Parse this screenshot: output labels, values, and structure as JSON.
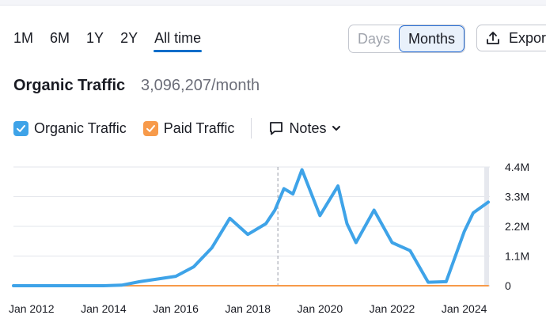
{
  "ranges": [
    {
      "label": "1M",
      "active": false
    },
    {
      "label": "6M",
      "active": false
    },
    {
      "label": "1Y",
      "active": false
    },
    {
      "label": "2Y",
      "active": false
    },
    {
      "label": "All time",
      "active": true
    }
  ],
  "granularity": {
    "days": "Days",
    "months": "Months",
    "selected": "Months"
  },
  "export_label": "Expor",
  "header": {
    "title": "Organic Traffic",
    "value": "3,096,207/month"
  },
  "legend": {
    "organic": "Organic Traffic",
    "paid": "Paid Traffic",
    "notes": "Notes"
  },
  "colors": {
    "organic": "#3ea3e8",
    "paid": "#f79a4a",
    "accent": "#006dca"
  },
  "chart_data": {
    "type": "line",
    "yticks": [
      "4.4M",
      "3.3M",
      "2.2M",
      "1.1M",
      "0"
    ],
    "ylim": [
      0,
      4400000
    ],
    "xticks": [
      "Jan 2012",
      "Jan 2014",
      "Jan 2016",
      "Jan 2018",
      "Jan 2020",
      "Jan 2022",
      "Jan 2024"
    ],
    "xlim": [
      "2011-07",
      "2024-09"
    ],
    "series": [
      {
        "name": "Organic Traffic",
        "color": "#3ea3e8",
        "x": [
          "2011-07",
          "2012-01",
          "2013-01",
          "2014-01",
          "2014-07",
          "2015-01",
          "2015-07",
          "2016-01",
          "2016-07",
          "2017-01",
          "2017-07",
          "2018-01",
          "2018-07",
          "2018-10",
          "2019-01",
          "2019-04",
          "2019-07",
          "2020-01",
          "2020-07",
          "2020-10",
          "2021-01",
          "2021-07",
          "2022-01",
          "2022-07",
          "2023-01",
          "2023-07",
          "2024-01",
          "2024-04",
          "2024-09"
        ],
        "values": [
          0,
          0,
          0,
          0,
          20000,
          150000,
          250000,
          350000,
          700000,
          1400000,
          2500000,
          1900000,
          2300000,
          2800000,
          3600000,
          3400000,
          4300000,
          2600000,
          3700000,
          2300000,
          1600000,
          2800000,
          1600000,
          1300000,
          130000,
          150000,
          2000000,
          2700000,
          3096207
        ]
      },
      {
        "name": "Paid Traffic",
        "color": "#f79a4a",
        "x": [
          "2011-07",
          "2024-09"
        ],
        "values": [
          0,
          0
        ]
      }
    ],
    "annotation_line_x": "2018-11",
    "grid": true
  }
}
